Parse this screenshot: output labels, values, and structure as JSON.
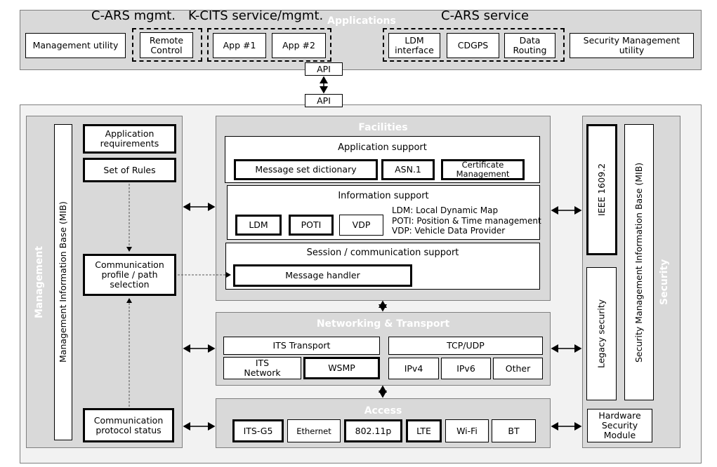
{
  "applications": {
    "title": "Applications",
    "group_cars_mgmt": "C-ARS mgmt.",
    "group_kcits": "K-CITS service/mgmt.",
    "group_cars_service": "C-ARS service",
    "management_utility": "Management utility",
    "remote_control": "Remote Control",
    "app1": "App #1",
    "app2": "App #2",
    "ldm_interface": "LDM interface",
    "cdgps": "CDGPS",
    "data_routing": "Data Routing",
    "security_management_utility": "Security Management utility"
  },
  "api": {
    "top": "API",
    "bottom": "API"
  },
  "management": {
    "title": "Management",
    "mib": "Management Information Base (MIB)",
    "application_requirements": "Application requirements",
    "set_of_rules": "Set of Rules",
    "communication_profile": "Communication profile / path selection",
    "communication_protocol_status": "Communication protocol status"
  },
  "facilities": {
    "title": "Facilities",
    "application_support": {
      "title": "Application support",
      "message_set_dictionary": "Message set dictionary",
      "asn1": "ASN.1",
      "certificate_management": "Certificate Management"
    },
    "information_support": {
      "title": "Information support",
      "ldm": "LDM",
      "poti": "POTI",
      "vdp": "VDP",
      "legend": [
        "LDM: Local Dynamic Map",
        "POTI: Position & Time management",
        "VDP: Vehicle Data Provider"
      ]
    },
    "session_support": {
      "title": "Session / communication support",
      "message_handler": "Message handler"
    }
  },
  "networking": {
    "title": "Networking & Transport",
    "its_transport": "ITS Transport",
    "its_network": "ITS Network",
    "wsmp": "WSMP",
    "tcp_udp": "TCP/UDP",
    "ipv4": "IPv4",
    "ipv6": "IPv6",
    "other": "Other"
  },
  "access": {
    "title": "Access",
    "items": [
      "ITS-G5",
      "Ethernet",
      "802.11p",
      "LTE",
      "Wi-Fi",
      "BT"
    ]
  },
  "security": {
    "title": "Security",
    "ieee": "IEEE 1609.2",
    "legacy": "Legacy security",
    "mib": "Security Management Information Base (MIB)",
    "hsm": "Hardware Security Module"
  }
}
